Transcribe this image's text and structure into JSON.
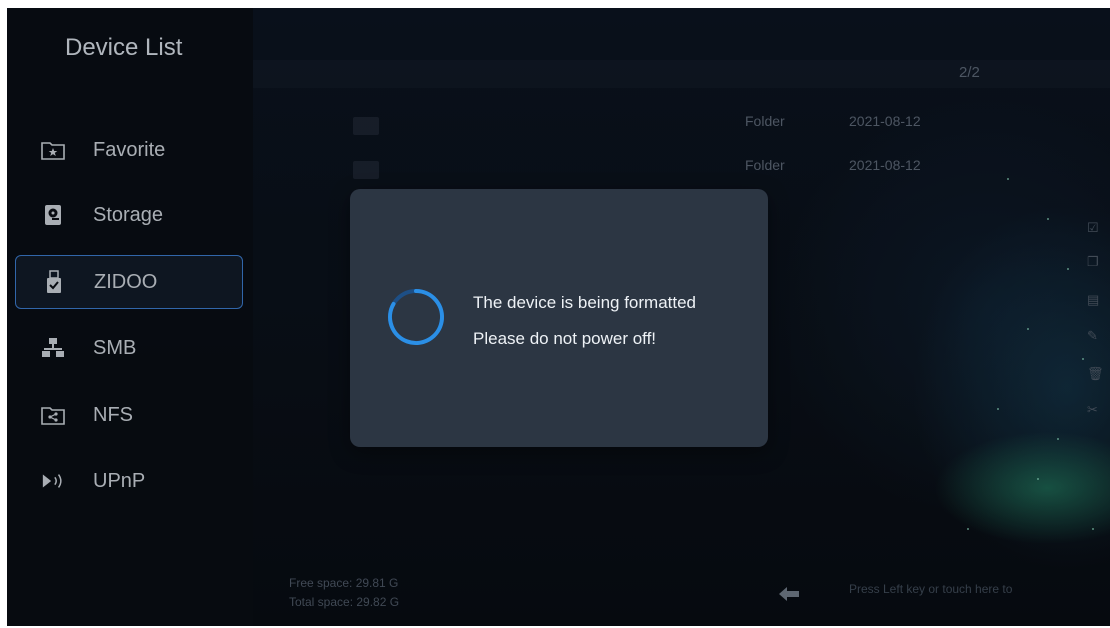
{
  "sidebar": {
    "title": "Device List",
    "items": [
      {
        "label": "Favorite",
        "icon": "favorite-folder-icon"
      },
      {
        "label": "Storage",
        "icon": "storage-disk-icon"
      },
      {
        "label": "ZIDOO",
        "icon": "usb-drive-icon",
        "selected": true
      },
      {
        "label": "SMB",
        "icon": "network-icon"
      },
      {
        "label": "NFS",
        "icon": "nfs-folder-icon"
      },
      {
        "label": "UPnP",
        "icon": "upnp-play-icon"
      }
    ]
  },
  "file_list": {
    "page": "2/2",
    "rows": [
      {
        "type": "Folder",
        "date": "2021-08-12"
      },
      {
        "type": "Folder",
        "date": "2021-08-12"
      }
    ]
  },
  "footer": {
    "free_space": "Free space: 29.81 G",
    "total_space": "Total space: 29.82 G",
    "hint": "Press Left key or touch here to"
  },
  "dialog": {
    "line1": "The device is being formatted",
    "line2": "Please do not power off!"
  },
  "colors": {
    "accent": "#3a78c8",
    "spinner": "#2b8fe6",
    "dialog_bg": "#2c3643"
  }
}
